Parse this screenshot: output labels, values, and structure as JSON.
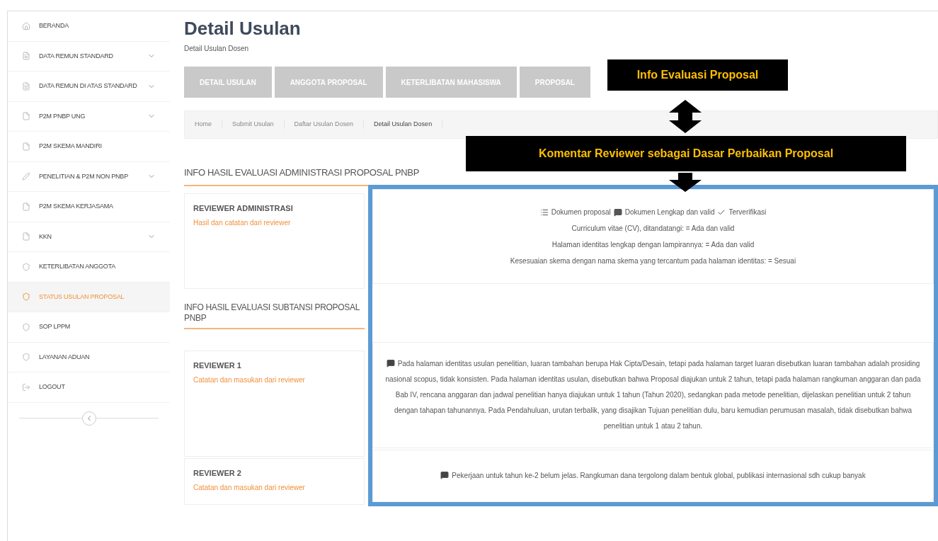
{
  "sidebar": {
    "items": [
      {
        "label": "BERANDA",
        "expandable": false,
        "selected": false
      },
      {
        "label": "DATA REMUN STANDARD",
        "expandable": true,
        "selected": false
      },
      {
        "label": "DATA REMUN DI ATAS STANDARD",
        "expandable": true,
        "selected": false
      },
      {
        "label": "P2M PNBP UNG",
        "expandable": true,
        "selected": false
      },
      {
        "label": "P2M SKEMA MANDIRI",
        "expandable": false,
        "selected": false
      },
      {
        "label": "PENELITIAN & P2M NON PNBP",
        "expandable": true,
        "selected": false
      },
      {
        "label": "P2M SKEMA KERJASAMA",
        "expandable": false,
        "selected": false
      },
      {
        "label": "KKN",
        "expandable": true,
        "selected": false
      },
      {
        "label": "KETERLIBATAN ANGGOTA",
        "expandable": false,
        "selected": false
      },
      {
        "label": "STATUS USULAN PROPOSAL",
        "expandable": false,
        "selected": true
      },
      {
        "label": "SOP LPPM",
        "expandable": false,
        "selected": false
      },
      {
        "label": "LAYANAN ADUAN",
        "expandable": false,
        "selected": false
      },
      {
        "label": "LOGOUT",
        "expandable": false,
        "selected": false
      }
    ]
  },
  "page": {
    "title": "Detail Usulan",
    "subtitle": "Detail Usulan Dosen"
  },
  "tabs": [
    {
      "label": "DETAIL USULAN",
      "selected": false
    },
    {
      "label": "ANGGOTA PROPOSAL",
      "selected": false
    },
    {
      "label": "KETERLIBATAN MAHASISWA",
      "selected": false
    },
    {
      "label": "PROPOSAL",
      "selected": false
    }
  ],
  "breadcrumb": [
    "Home",
    "Submit Usulan",
    "Daftar Usulan Dosen",
    "Detail Usulan Dosen"
  ],
  "annotations": [
    {
      "text": "Info Evaluasi Proposal"
    },
    {
      "text": "Komentar Reviewer sebagai Dasar Perbaikan Proposal"
    }
  ],
  "sections": [
    {
      "heading": "INFO HASIL EVALUASI ADMINISTRASI PROPOSAL PNBP",
      "reviewers": [
        {
          "name": "REVIEWER ADMINISTRASI",
          "note": "Hasil dan catatan dari reviewer",
          "lines": [
            {
              "kind": "badges",
              "items": [
                {
                  "kind": "document",
                  "text": "Dokumen proposal"
                },
                {
                  "kind": "comment",
                  "text": "Dokumen Lengkap dan valid"
                },
                {
                  "kind": "check",
                  "text": "Terverifikasi"
                }
              ]
            },
            {
              "kind": "text",
              "text": "Curriculum vitae (CV), ditandatangi: = Ada dan valid"
            },
            {
              "kind": "text",
              "text": "Halaman identitas lengkap dengan lampirannya: = Ada dan valid"
            },
            {
              "kind": "text",
              "text": "Kesesuaian skema dengan nama skema yang tercantum pada halaman identitas: = Sesuai"
            }
          ]
        }
      ]
    },
    {
      "heading": "INFO HASIL EVALUASI SUBTANSI PROPOSAL PNBP",
      "reviewers": [
        {
          "name": "REVIEWER 1",
          "note": "Catatan dan masukan dari reviewer",
          "lines": [
            {
              "kind": "comment",
              "text": "Pada halaman identitas usulan penelitian, luaran tambahan berupa Hak Cipta/Desain, tetapi pada halaman target luaran disebutkan luaran tambahan adalah prosiding nasional scopus, tidak konsisten. Pada halaman identitas usulan, disebutkan bahwa Proposal diajukan untuk 2 tahun, tetapi pada halaman rangkuman anggaran dan pada Bab IV, rencana anggaran dan jadwal penelitian hanya diajukan untuk 1 tahun (Tahun 2020), sedangkan pada metode penelitian, dijelaskan penelitian untuk 2 tahun dengan tahapan tahunannya. Pada Pendahuluan, urutan terbalik, yang disajikan Tujuan penelitian dulu, baru kemudian perumusan masalah, tidak disebutkan bahwa penelitian untuk 1 atau 2 tahun."
            }
          ]
        },
        {
          "name": "REVIEWER 2",
          "note": "Catatan dan masukan dari reviewer",
          "lines": [
            {
              "kind": "comment",
              "text": "Pekerjaan untuk tahun ke-2 belum jelas. Rangkuman dana tergolong dalam bentuk global, publikasi internasional sdh cukup banyak"
            }
          ]
        }
      ]
    }
  ]
}
